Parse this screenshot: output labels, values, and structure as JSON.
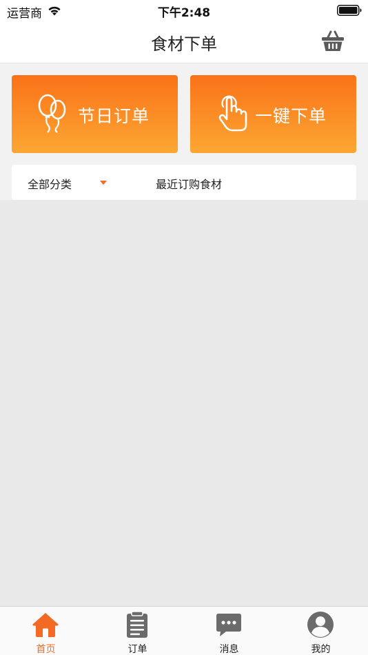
{
  "status_bar": {
    "carrier": "运营商",
    "time": "下午2:48"
  },
  "nav": {
    "title": "食材下单",
    "cart_icon": "basket-icon"
  },
  "actions": [
    {
      "label": "节日订单",
      "icon": "balloons-icon"
    },
    {
      "label": "一键下单",
      "icon": "tap-hand-icon"
    }
  ],
  "filter": {
    "category": "全部分类",
    "recent": "最近订购食材"
  },
  "tabs": [
    {
      "label": "首页",
      "icon": "home-icon",
      "active": true
    },
    {
      "label": "订单",
      "icon": "clipboard-icon",
      "active": false
    },
    {
      "label": "消息",
      "icon": "chat-bubble-icon",
      "active": false
    },
    {
      "label": "我的",
      "icon": "user-avatar-icon",
      "active": false
    }
  ],
  "colors": {
    "accent": "#f26a23",
    "button_gradient_top": "#fa7218",
    "button_gradient_bottom": "#fca733",
    "inactive_icon": "#6b6b6b",
    "background": "#e9e9e9"
  }
}
